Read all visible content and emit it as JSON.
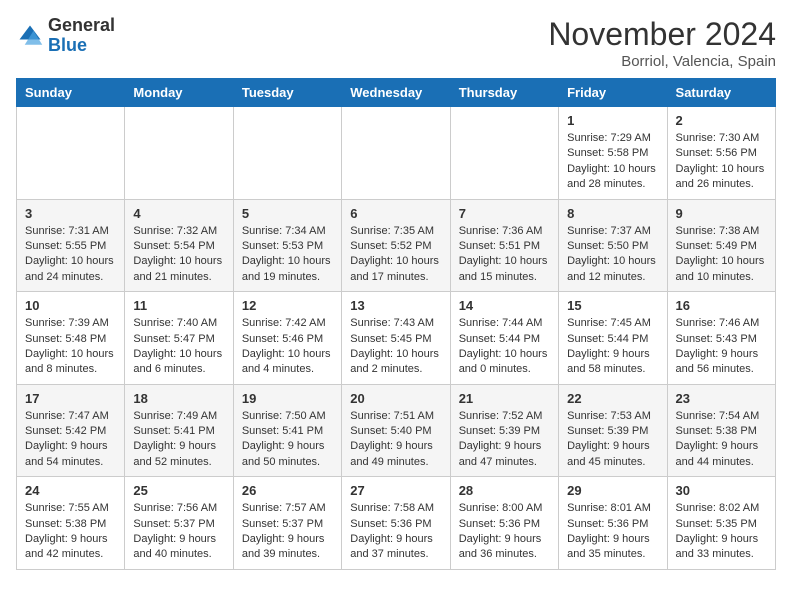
{
  "header": {
    "logo_line1": "General",
    "logo_line2": "Blue",
    "month_title": "November 2024",
    "location": "Borriol, Valencia, Spain"
  },
  "weekdays": [
    "Sunday",
    "Monday",
    "Tuesday",
    "Wednesday",
    "Thursday",
    "Friday",
    "Saturday"
  ],
  "weeks": [
    [
      {
        "day": "",
        "info": ""
      },
      {
        "day": "",
        "info": ""
      },
      {
        "day": "",
        "info": ""
      },
      {
        "day": "",
        "info": ""
      },
      {
        "day": "",
        "info": ""
      },
      {
        "day": "1",
        "info": "Sunrise: 7:29 AM\nSunset: 5:58 PM\nDaylight: 10 hours and 28 minutes."
      },
      {
        "day": "2",
        "info": "Sunrise: 7:30 AM\nSunset: 5:56 PM\nDaylight: 10 hours and 26 minutes."
      }
    ],
    [
      {
        "day": "3",
        "info": "Sunrise: 7:31 AM\nSunset: 5:55 PM\nDaylight: 10 hours and 24 minutes."
      },
      {
        "day": "4",
        "info": "Sunrise: 7:32 AM\nSunset: 5:54 PM\nDaylight: 10 hours and 21 minutes."
      },
      {
        "day": "5",
        "info": "Sunrise: 7:34 AM\nSunset: 5:53 PM\nDaylight: 10 hours and 19 minutes."
      },
      {
        "day": "6",
        "info": "Sunrise: 7:35 AM\nSunset: 5:52 PM\nDaylight: 10 hours and 17 minutes."
      },
      {
        "day": "7",
        "info": "Sunrise: 7:36 AM\nSunset: 5:51 PM\nDaylight: 10 hours and 15 minutes."
      },
      {
        "day": "8",
        "info": "Sunrise: 7:37 AM\nSunset: 5:50 PM\nDaylight: 10 hours and 12 minutes."
      },
      {
        "day": "9",
        "info": "Sunrise: 7:38 AM\nSunset: 5:49 PM\nDaylight: 10 hours and 10 minutes."
      }
    ],
    [
      {
        "day": "10",
        "info": "Sunrise: 7:39 AM\nSunset: 5:48 PM\nDaylight: 10 hours and 8 minutes."
      },
      {
        "day": "11",
        "info": "Sunrise: 7:40 AM\nSunset: 5:47 PM\nDaylight: 10 hours and 6 minutes."
      },
      {
        "day": "12",
        "info": "Sunrise: 7:42 AM\nSunset: 5:46 PM\nDaylight: 10 hours and 4 minutes."
      },
      {
        "day": "13",
        "info": "Sunrise: 7:43 AM\nSunset: 5:45 PM\nDaylight: 10 hours and 2 minutes."
      },
      {
        "day": "14",
        "info": "Sunrise: 7:44 AM\nSunset: 5:44 PM\nDaylight: 10 hours and 0 minutes."
      },
      {
        "day": "15",
        "info": "Sunrise: 7:45 AM\nSunset: 5:44 PM\nDaylight: 9 hours and 58 minutes."
      },
      {
        "day": "16",
        "info": "Sunrise: 7:46 AM\nSunset: 5:43 PM\nDaylight: 9 hours and 56 minutes."
      }
    ],
    [
      {
        "day": "17",
        "info": "Sunrise: 7:47 AM\nSunset: 5:42 PM\nDaylight: 9 hours and 54 minutes."
      },
      {
        "day": "18",
        "info": "Sunrise: 7:49 AM\nSunset: 5:41 PM\nDaylight: 9 hours and 52 minutes."
      },
      {
        "day": "19",
        "info": "Sunrise: 7:50 AM\nSunset: 5:41 PM\nDaylight: 9 hours and 50 minutes."
      },
      {
        "day": "20",
        "info": "Sunrise: 7:51 AM\nSunset: 5:40 PM\nDaylight: 9 hours and 49 minutes."
      },
      {
        "day": "21",
        "info": "Sunrise: 7:52 AM\nSunset: 5:39 PM\nDaylight: 9 hours and 47 minutes."
      },
      {
        "day": "22",
        "info": "Sunrise: 7:53 AM\nSunset: 5:39 PM\nDaylight: 9 hours and 45 minutes."
      },
      {
        "day": "23",
        "info": "Sunrise: 7:54 AM\nSunset: 5:38 PM\nDaylight: 9 hours and 44 minutes."
      }
    ],
    [
      {
        "day": "24",
        "info": "Sunrise: 7:55 AM\nSunset: 5:38 PM\nDaylight: 9 hours and 42 minutes."
      },
      {
        "day": "25",
        "info": "Sunrise: 7:56 AM\nSunset: 5:37 PM\nDaylight: 9 hours and 40 minutes."
      },
      {
        "day": "26",
        "info": "Sunrise: 7:57 AM\nSunset: 5:37 PM\nDaylight: 9 hours and 39 minutes."
      },
      {
        "day": "27",
        "info": "Sunrise: 7:58 AM\nSunset: 5:36 PM\nDaylight: 9 hours and 37 minutes."
      },
      {
        "day": "28",
        "info": "Sunrise: 8:00 AM\nSunset: 5:36 PM\nDaylight: 9 hours and 36 minutes."
      },
      {
        "day": "29",
        "info": "Sunrise: 8:01 AM\nSunset: 5:36 PM\nDaylight: 9 hours and 35 minutes."
      },
      {
        "day": "30",
        "info": "Sunrise: 8:02 AM\nSunset: 5:35 PM\nDaylight: 9 hours and 33 minutes."
      }
    ]
  ]
}
